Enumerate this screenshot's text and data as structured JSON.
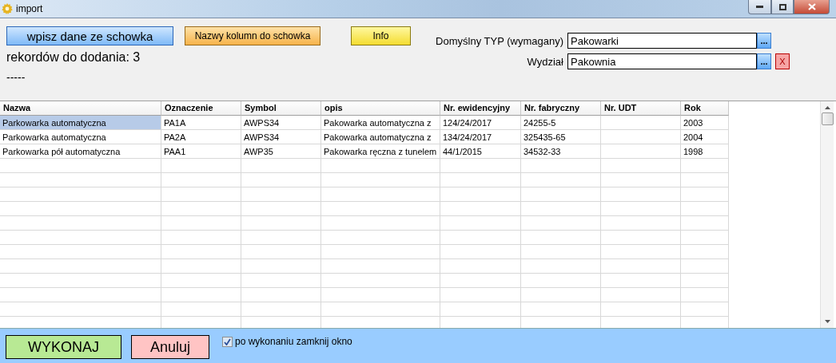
{
  "window": {
    "title": "import"
  },
  "toolbar": {
    "paste_button": "wpisz dane ze schowka",
    "columns_button": "Nazwy kolumn do schowka",
    "info_button": "Info",
    "records_label": "rekordów do dodania: 3",
    "status_text": "-----"
  },
  "fields": [
    {
      "label": "Domyślny TYP (wymagany)",
      "value": "Pakowarki",
      "browse": "..."
    },
    {
      "label": "Wydział",
      "value": "Pakownia",
      "browse": "...",
      "clear": "X"
    }
  ],
  "table": {
    "columns": [
      "Nazwa",
      "Oznaczenie",
      "Symbol",
      "opis",
      "Nr. ewidencyjny",
      "Nr. fabryczny",
      "Nr. UDT",
      "Rok"
    ],
    "rows": [
      {
        "selected": true,
        "cells": [
          "Parkowarka automatyczna",
          "PA1A",
          "AWPS34",
          "Pakowarka automatyczna z",
          "124/24/2017",
          "24255-5",
          "",
          "2003"
        ]
      },
      {
        "selected": false,
        "cells": [
          "Parkowarka automatyczna",
          "PA2A",
          "AWPS34",
          "Pakowarka automatyczna z",
          "134/24/2017",
          "325435-65",
          "",
          "2004"
        ]
      },
      {
        "selected": false,
        "cells": [
          "Parkowarka pół automatyczna",
          "PAA1",
          "AWP35",
          "Pakowarka ręczna  z tunelem",
          "44/1/2015",
          "34532-33",
          "",
          "1998"
        ]
      }
    ]
  },
  "footer": {
    "execute_button": "WYKONAJ",
    "cancel_button": "Anuluj",
    "close_checkbox": {
      "label": "po wykonaniu zamknij okno",
      "checked": true
    }
  }
}
